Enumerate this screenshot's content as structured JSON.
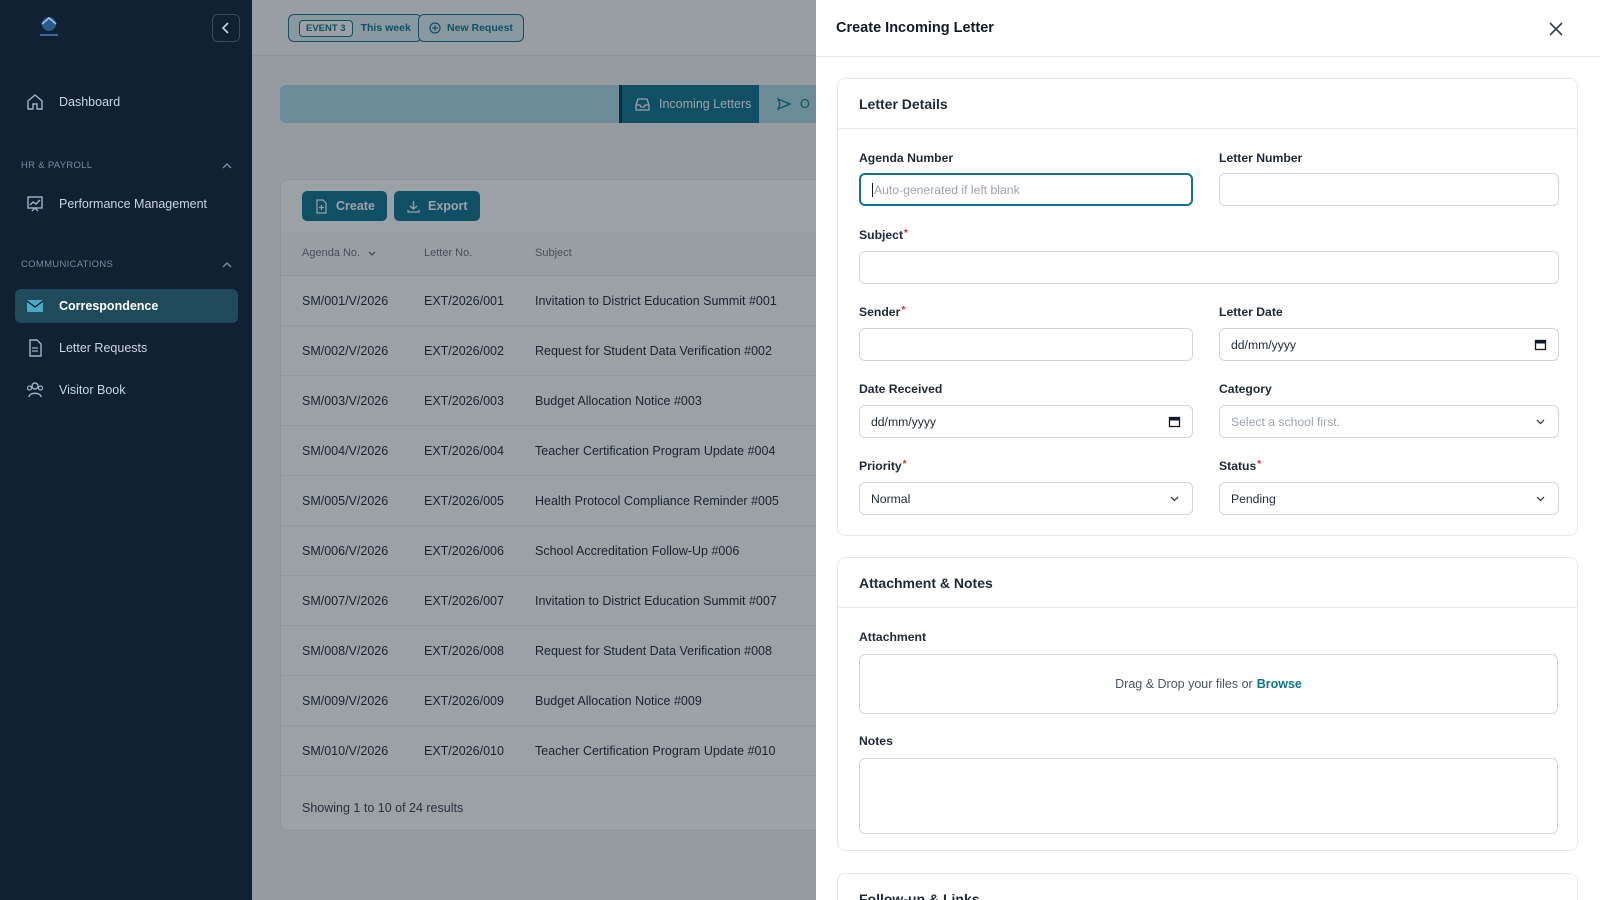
{
  "sidebar": {
    "items": [
      {
        "label": "Dashboard"
      },
      {
        "label": "Performance Management"
      },
      {
        "label": "Correspondence"
      },
      {
        "label": "Letter Requests"
      },
      {
        "label": "Visitor Book"
      }
    ],
    "sections": [
      {
        "label": "HR & PAYROLL"
      },
      {
        "label": "COMMUNICATIONS"
      }
    ],
    "active_color": "#1f4a5a"
  },
  "topbar": {
    "event_badge": "EVENT 3",
    "event_period": "This week",
    "new_request": "New Request"
  },
  "tabs": {
    "incoming": "Incoming Letters",
    "outgoing_partial": "O"
  },
  "toolbar": {
    "create": "Create",
    "export": "Export"
  },
  "table": {
    "headers": [
      "Agenda No.",
      "Letter No.",
      "Subject"
    ],
    "rows": [
      [
        "SM/001/V/2026",
        "EXT/2026/001",
        "Invitation to District Education Summit #001"
      ],
      [
        "SM/002/V/2026",
        "EXT/2026/002",
        "Request for Student Data Verification #002"
      ],
      [
        "SM/003/V/2026",
        "EXT/2026/003",
        "Budget Allocation Notice #003"
      ],
      [
        "SM/004/V/2026",
        "EXT/2026/004",
        "Teacher Certification Program Update #004"
      ],
      [
        "SM/005/V/2026",
        "EXT/2026/005",
        "Health Protocol Compliance Reminder #005"
      ],
      [
        "SM/006/V/2026",
        "EXT/2026/006",
        "School Accreditation Follow-Up #006"
      ],
      [
        "SM/007/V/2026",
        "EXT/2026/007",
        "Invitation to District Education Summit #007"
      ],
      [
        "SM/008/V/2026",
        "EXT/2026/008",
        "Request for Student Data Verification #008"
      ],
      [
        "SM/009/V/2026",
        "EXT/2026/009",
        "Budget Allocation Notice #009"
      ],
      [
        "SM/010/V/2026",
        "EXT/2026/010",
        "Teacher Certification Program Update #010"
      ]
    ],
    "footer": "Showing 1 to 10 of 24 results"
  },
  "drawer": {
    "title": "Create Incoming Letter",
    "details_title": "Letter Details",
    "agenda_label": "Agenda Number",
    "agenda_placeholder": "Auto-generated if left blank",
    "letter_number_label": "Letter Number",
    "subject_label": "Subject",
    "sender_label": "Sender",
    "letter_date_label": "Letter Date",
    "date_placeholder": "dd/mm/yyyy",
    "date_received_label": "Date Received",
    "category_label": "Category",
    "category_placeholder": "Select a school first.",
    "priority_label": "Priority",
    "priority_value": "Normal",
    "status_label": "Status",
    "status_value": "Pending",
    "required_mark": "*",
    "attachment_section_title": "Attachment & Notes",
    "attachment_label": "Attachment",
    "drop_text": "Drag & Drop your files or",
    "browse": "Browse",
    "notes_label": "Notes",
    "followup_title": "Follow-up & Links"
  },
  "colors": {
    "accent": "#0e7490",
    "sidebar_bg": "#0f2132",
    "required": "#dc2626"
  }
}
